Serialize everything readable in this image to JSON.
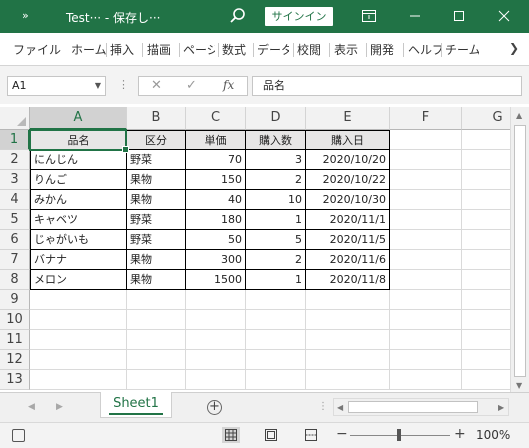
{
  "window": {
    "quick_access": "»",
    "title": "Test··· - 保存し···",
    "signin_label": "サインイン"
  },
  "ribbon": {
    "tabs": [
      "ファイル",
      "ホーム",
      "挿入",
      "描画",
      "ページ",
      "数式",
      "データ",
      "校閲",
      "表示",
      "開発",
      "ヘルプ",
      "チーム"
    ]
  },
  "formula_bar": {
    "name_box": "A1",
    "fx_label": "fx",
    "value": "品名"
  },
  "grid": {
    "columns": [
      "A",
      "B",
      "C",
      "D",
      "E",
      "F",
      "G"
    ],
    "rows": [
      "1",
      "2",
      "3",
      "4",
      "5",
      "6",
      "7",
      "8",
      "9",
      "10",
      "11",
      "12",
      "13"
    ],
    "header": [
      "品名",
      "区分",
      "単価",
      "購入数",
      "購入日"
    ],
    "data": [
      [
        "にんじん",
        "野菜",
        "70",
        "3",
        "2020/10/20"
      ],
      [
        "りんご",
        "果物",
        "150",
        "2",
        "2020/10/22"
      ],
      [
        "みかん",
        "果物",
        "40",
        "10",
        "2020/10/30"
      ],
      [
        "キャベツ",
        "野菜",
        "180",
        "1",
        "2020/11/1"
      ],
      [
        "じゃがいも",
        "野菜",
        "50",
        "5",
        "2020/11/5"
      ],
      [
        "バナナ",
        "果物",
        "300",
        "2",
        "2020/11/6"
      ],
      [
        "メロン",
        "果物",
        "1500",
        "1",
        "2020/11/8"
      ]
    ]
  },
  "sheets": {
    "active": "Sheet1"
  },
  "status": {
    "zoom": "100%"
  },
  "colors": {
    "accent": "#217346"
  }
}
